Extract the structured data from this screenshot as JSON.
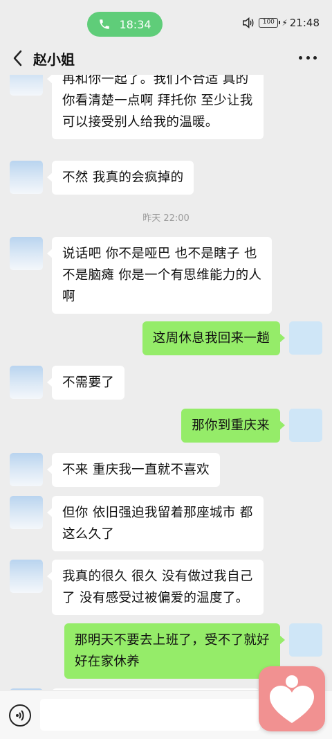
{
  "status": {
    "call_time": "18:34",
    "battery": "100",
    "clock": "21:48"
  },
  "header": {
    "title": "赵小姐"
  },
  "messages": {
    "m0": [
      "再和你一起了。我们不合适 真的",
      "你看清楚一点啊 拜托你  至少让我",
      "可以接受别人给我的温暖。"
    ],
    "m1": [
      "不然 我真的会疯掉的"
    ],
    "time1": "昨天 22:00",
    "m2": [
      "说话吧 你不是哑巴 也不是瞎子 也",
      "不是脑瘫 你是一个有思维能力的人",
      "啊"
    ],
    "m3": [
      "这周休息我回来一趟"
    ],
    "m4": [
      "不需要了"
    ],
    "m5": [
      "那你到重庆来"
    ],
    "m6": [
      "不来 重庆我一直就不喜欢"
    ],
    "m7": [
      "但你 依旧强迫我留着那座城市 都",
      "这么久了"
    ],
    "m8": [
      "我真的很久 很久 没有做过我自己",
      "了 没有感受过被偏爱的温度了。"
    ],
    "m9": [
      "那明天不要去上班了，受不了就好",
      "好在家休养"
    ]
  },
  "colors": {
    "call_green": "#5fcd79",
    "bubble_out": "#95ec69",
    "bubble_in": "#ffffff",
    "background": "#ededed",
    "heart_fab": "#f19191"
  },
  "icons": [
    "phone-icon",
    "speaker-icon",
    "back-icon",
    "more-icon",
    "voice-icon",
    "heart-icon"
  ]
}
